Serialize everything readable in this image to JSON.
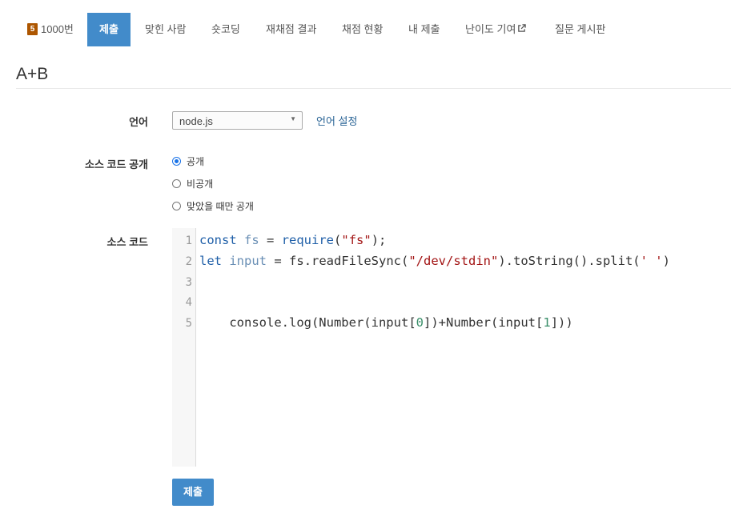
{
  "nav": {
    "problem_badge": "5",
    "problem_number": "1000번",
    "items": [
      {
        "label": "제출"
      },
      {
        "label": "맞힌 사람"
      },
      {
        "label": "숏코딩"
      },
      {
        "label": "재채점 결과"
      },
      {
        "label": "채점 현황"
      },
      {
        "label": "내 제출"
      },
      {
        "label": "난이도 기여"
      },
      {
        "label": "질문 게시판"
      }
    ]
  },
  "page": {
    "title": "A+B"
  },
  "form": {
    "language_label": "언어",
    "language_value": "node.js",
    "language_settings_link": "언어 설정",
    "visibility_label": "소스 코드 공개",
    "visibility_options": [
      {
        "label": "공개",
        "checked": true
      },
      {
        "label": "비공개",
        "checked": false
      },
      {
        "label": "맞았을 때만 공개",
        "checked": false
      }
    ],
    "source_label": "소스 코드",
    "submit_label": "제출"
  },
  "editor": {
    "line_numbers": [
      "1",
      "2",
      "3",
      "4",
      "5"
    ],
    "lines": [
      "const fs = require(\"fs\");",
      "let input = fs.readFileSync(\"/dev/stdin\").toString().split(' ')",
      "",
      "",
      "    console.log(Number(input[0])+Number(input[1]))"
    ]
  },
  "colors": {
    "accent": "#428bca",
    "badge": "#ad5600",
    "link": "#2a6496"
  }
}
